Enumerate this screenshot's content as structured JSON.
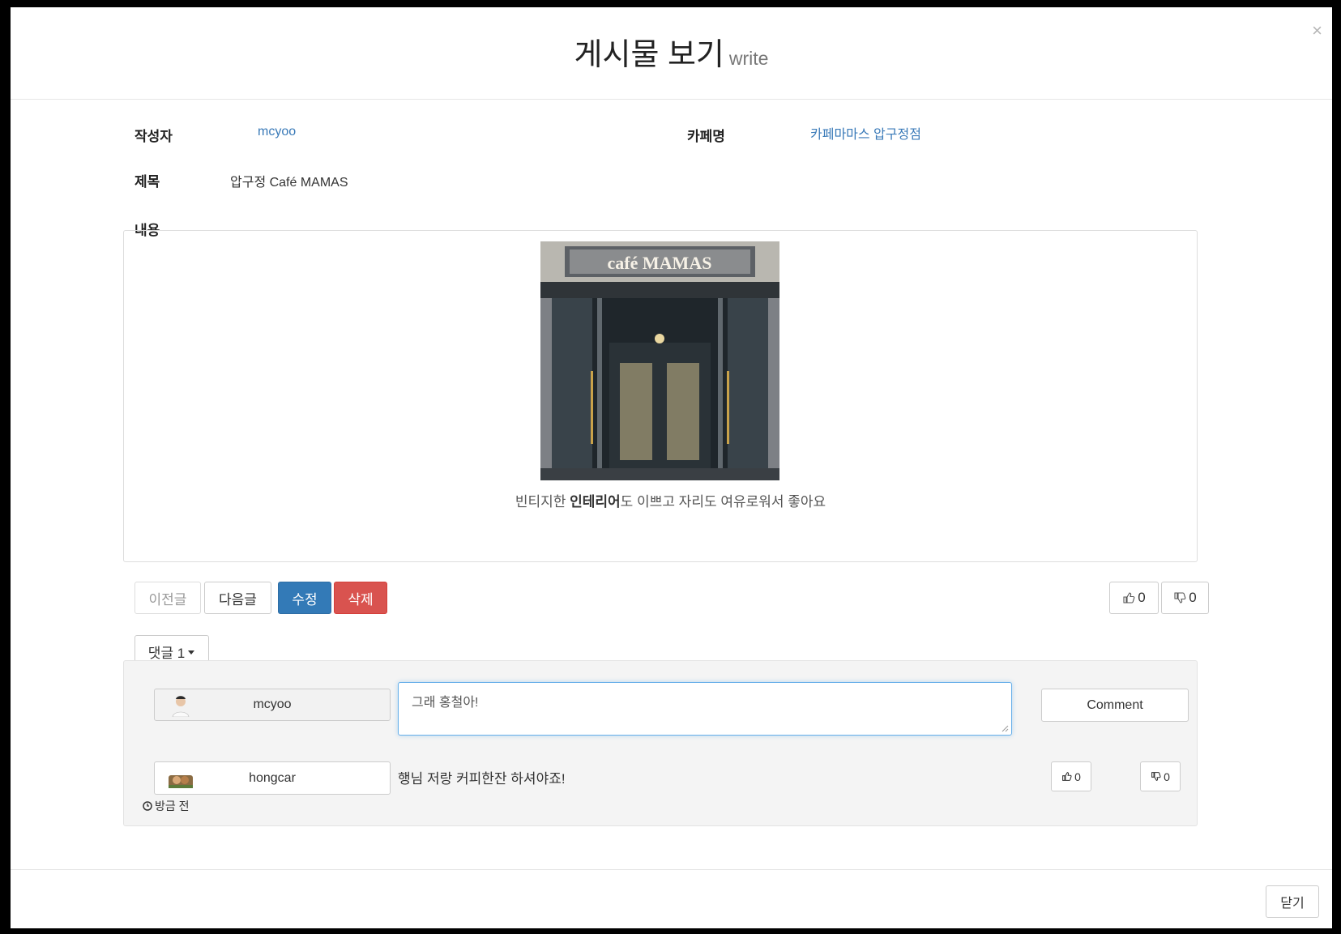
{
  "modal": {
    "title": "게시물 보기",
    "subtitle": "write",
    "close_glyph": "×",
    "close_button": "닫기"
  },
  "post": {
    "author_label": "작성자",
    "author": "mcyoo",
    "cafe_label": "카페명",
    "cafe_name": "카페마마스 압구정점",
    "title_label": "제목",
    "title": "압구정 Café MAMAS",
    "content_label": "내용",
    "image_sign": "café MAMAS",
    "caption_before": "빈티지한 ",
    "caption_bold": "인테리어",
    "caption_after": "도 이쁘고 자리도 여유로워서 좋아요"
  },
  "actions": {
    "prev": "이전글",
    "next": "다음글",
    "edit": "수정",
    "delete": "삭제",
    "like_count": "0",
    "dislike_count": "0"
  },
  "comments": {
    "toggle_label": "댓글 1",
    "current_user": "mcyoo",
    "input_value": "그래 홍철아!",
    "submit_label": "Comment",
    "items": [
      {
        "user": "hongcar",
        "text": "행님 저랑 커피한잔 하셔야죠!",
        "time": "방금 전",
        "likes": "0",
        "dislikes": "0"
      }
    ]
  },
  "colors": {
    "primary": "#337ab7",
    "danger": "#d9534f",
    "link": "#3a7ab8"
  },
  "icons": [
    "close-icon",
    "thumbs-up-icon",
    "thumbs-down-icon",
    "caret-down-icon",
    "clock-icon",
    "avatar-icon"
  ]
}
